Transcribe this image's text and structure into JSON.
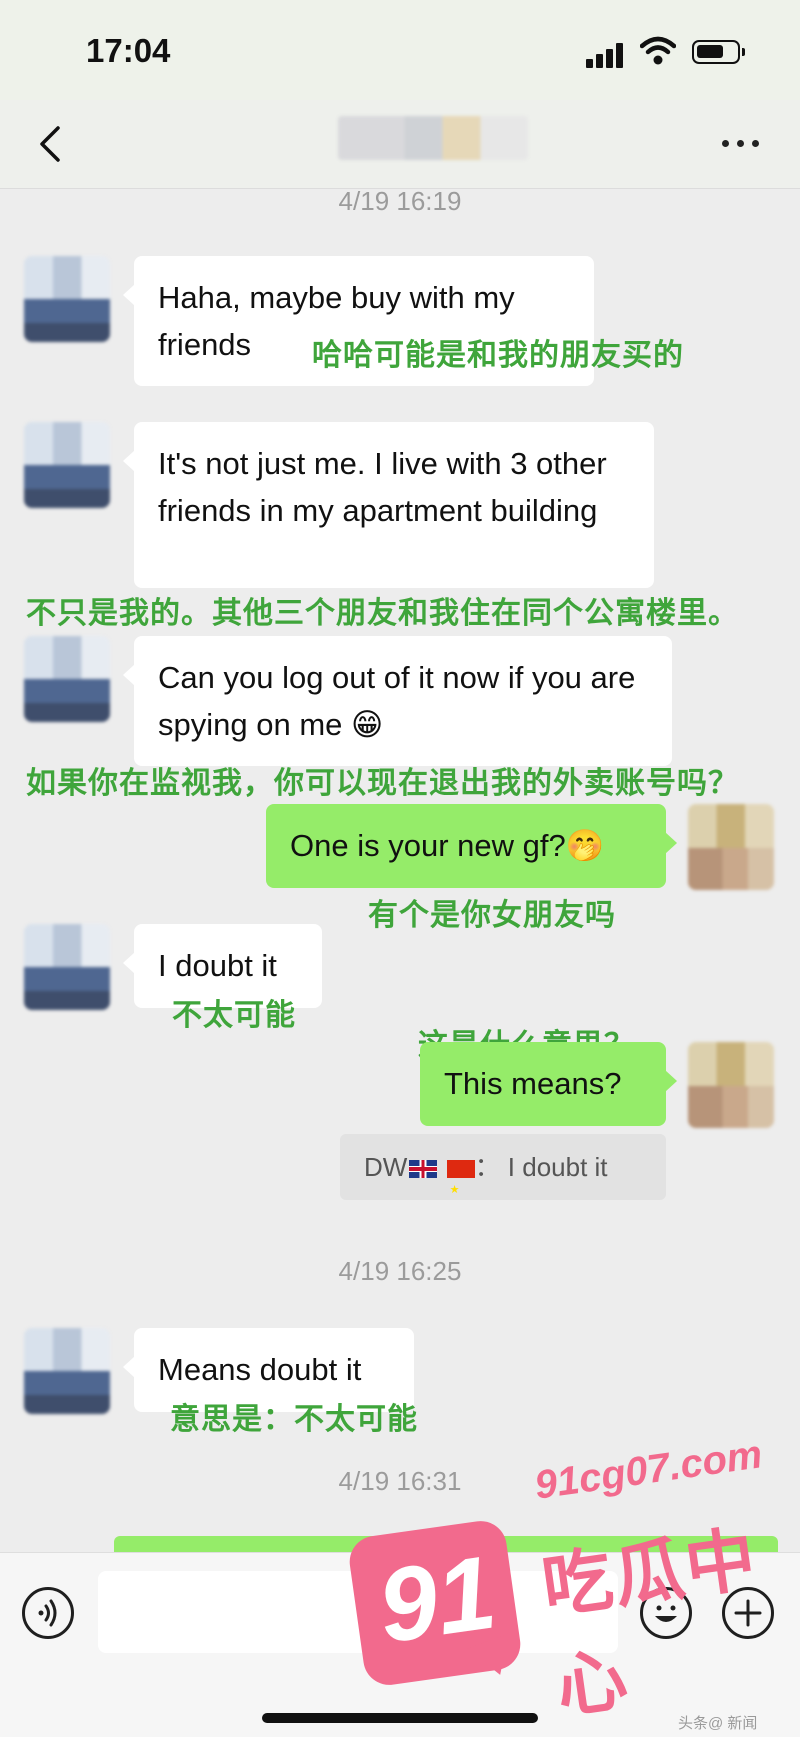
{
  "status_bar": {
    "time": "17:04"
  },
  "header": {
    "title": ""
  },
  "timestamps": [
    "4/19 16:19",
    "4/19 16:25",
    "4/19 16:31"
  ],
  "messages": [
    {
      "side": "in",
      "text": "Haha, maybe buy with my friends"
    },
    {
      "side": "in",
      "text": "It's not just me. I live with 3 other friends in my apartment building"
    },
    {
      "side": "in",
      "text": "Can you log out of it now if you are spying on me 😁"
    },
    {
      "side": "out",
      "text": "One is your new gf?🤭"
    },
    {
      "side": "in",
      "text": "I doubt it"
    },
    {
      "side": "out",
      "text": "This means?"
    },
    {
      "side": "in",
      "text": "Means doubt it"
    }
  ],
  "annotations": [
    "哈哈可能是和我的朋友买的",
    "不只是我的。其他三个朋友和我住在同个公寓楼里。",
    "如果你在监视我，你可以现在退出我的外卖账号吗？",
    "有个是你女朋友吗",
    "不太可能",
    "这是什么意思？",
    "意思是：不太可能"
  ],
  "quote": {
    "sender": "DW",
    "text": "：  I doubt it"
  },
  "watermark": {
    "number": "91",
    "url": "91cg07.com",
    "name": "吃瓜中心",
    "small": "头条@ 新闻"
  },
  "colors": {
    "sent_bubble": "#95ec69",
    "received_bubble": "#ffffff",
    "annotation": "#3fa53b",
    "watermark": "#f26a8d"
  }
}
